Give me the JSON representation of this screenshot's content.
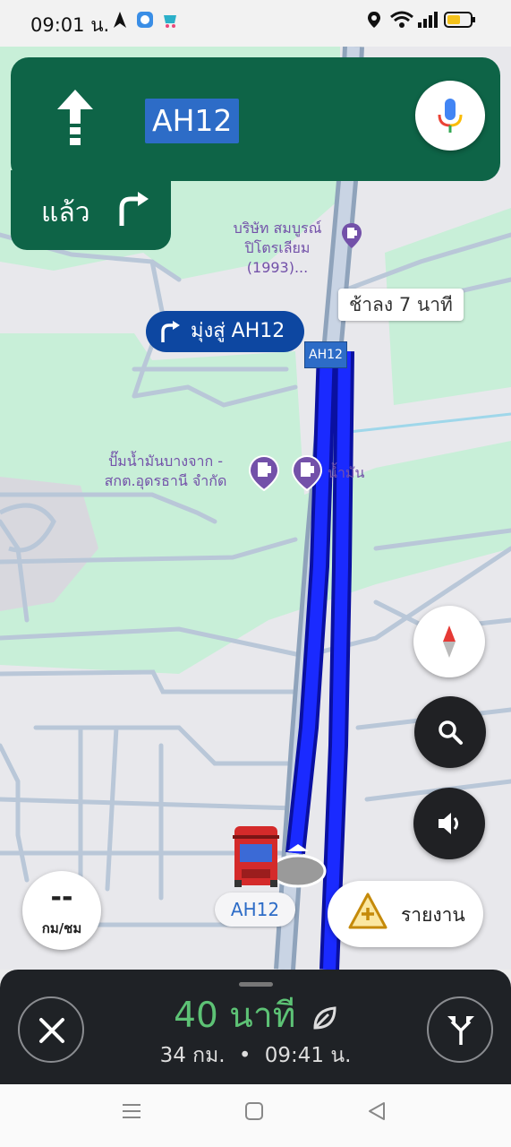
{
  "status_bar": {
    "time": "09:01 น.",
    "icons": [
      "navigation-arrow-icon",
      "app-icon",
      "store-icon",
      "location-icon",
      "wifi-icon",
      "signal-icon",
      "battery-icon"
    ]
  },
  "navigation": {
    "direction_icon": "straight-arrow-icon",
    "road_name": "AH12",
    "then_label": "แล้ว",
    "then_icon": "turn-right-icon",
    "mic_icon": "microphone-icon"
  },
  "map": {
    "poi_1": {
      "line1": "บริษัท สมบูรณ์",
      "line2": "ปิโตรเลียม (1993)..."
    },
    "poi_2": {
      "line1": "ปั๊มน้ำมันบางจาก -",
      "line2": "สกต.อุดรธานี จำกัด"
    },
    "poi_3": {
      "label": "น้ำมัน"
    },
    "delay_callout": "ช้าลง 7 นาที",
    "toward_callout": "มุ่งสู่ AH12",
    "road_shield": "AH12",
    "current_road": "AH12"
  },
  "controls": {
    "compass_icon": "compass-icon",
    "search_icon": "search-icon",
    "sound_icon": "sound-icon",
    "speed_value": "--",
    "speed_unit": "กม/ชม",
    "report_label": "รายงาน",
    "report_icon": "report-incident-icon"
  },
  "trip": {
    "duration": "40 นาที",
    "eco_icon": "leaf-icon",
    "distance": "34 กม.",
    "separator": "•",
    "arrival": "09:41 น.",
    "close_icon": "close-icon",
    "routes_icon": "alternate-routes-icon"
  },
  "system_nav": {
    "menu_icon": "menu-icon",
    "home_icon": "home-icon",
    "back_icon": "back-icon"
  },
  "colors": {
    "nav_green": "#0e6447",
    "route_blue": "#1a2aff",
    "eta_green": "#5dc275",
    "poi_purple": "#7351a9",
    "shield_blue": "#2d6cc7"
  }
}
